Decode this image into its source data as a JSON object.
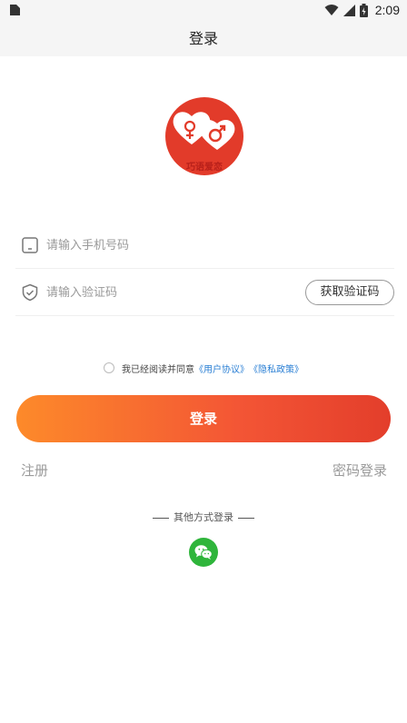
{
  "status_bar": {
    "time": "2:09"
  },
  "header": {
    "title": "登录"
  },
  "logo": {
    "text": "巧语爱恋"
  },
  "form": {
    "phone_placeholder": "请输入手机号码",
    "code_placeholder": "请输入验证码",
    "get_code_label": "获取验证码"
  },
  "agreement": {
    "text": "我已经阅读并同意",
    "user_agreement": "《用户协议》",
    "privacy_policy": "《隐私政策》"
  },
  "login_label": "登录",
  "links": {
    "register": "注册",
    "password_login": "密码登录"
  },
  "other_login": {
    "title": "其他方式登录"
  },
  "colors": {
    "accent_start": "#fd8a2a",
    "accent_end": "#e33e2b",
    "link": "#2a7fd4",
    "wechat": "#2fb53b"
  },
  "icons": [
    "sim-card-icon",
    "wifi-icon",
    "signal-icon",
    "battery-icon",
    "phone-icon",
    "shield-check-icon",
    "wechat-icon"
  ]
}
